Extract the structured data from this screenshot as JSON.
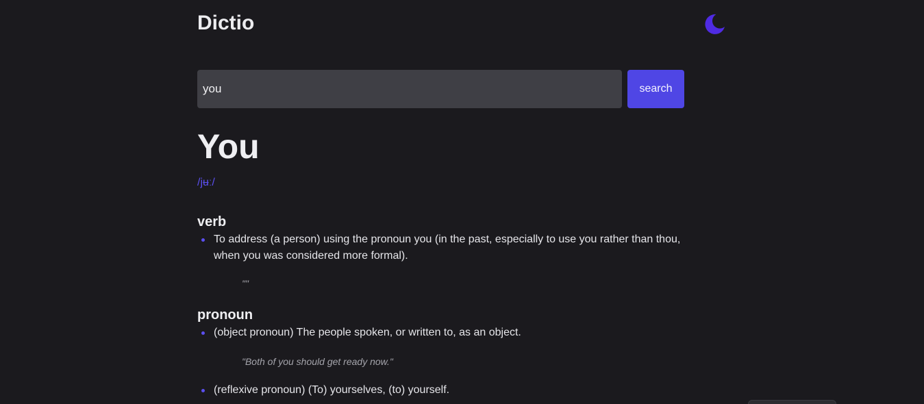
{
  "header": {
    "logo": "Dictio",
    "theme_toggle_icon": "moon-icon",
    "accent_color": "#4f46e5"
  },
  "search": {
    "value": "you",
    "button_label": "search"
  },
  "entry": {
    "word": "You",
    "phonetic": "/jʉː/",
    "meanings": [
      {
        "part_of_speech": "verb",
        "definitions": [
          {
            "line1": "To address (a person) using the pronoun you (in the past, especially to use you rather than thou,",
            "line2": "when you was considered more formal).",
            "example": "\"\""
          }
        ]
      },
      {
        "part_of_speech": "pronoun",
        "definitions": [
          {
            "text": "(object pronoun) The people spoken, or written to, as an object.",
            "example": "\"Both of you should get ready now.\""
          },
          {
            "text": "(reflexive pronoun) (To) yourselves, (to) yourself."
          }
        ]
      }
    ]
  }
}
